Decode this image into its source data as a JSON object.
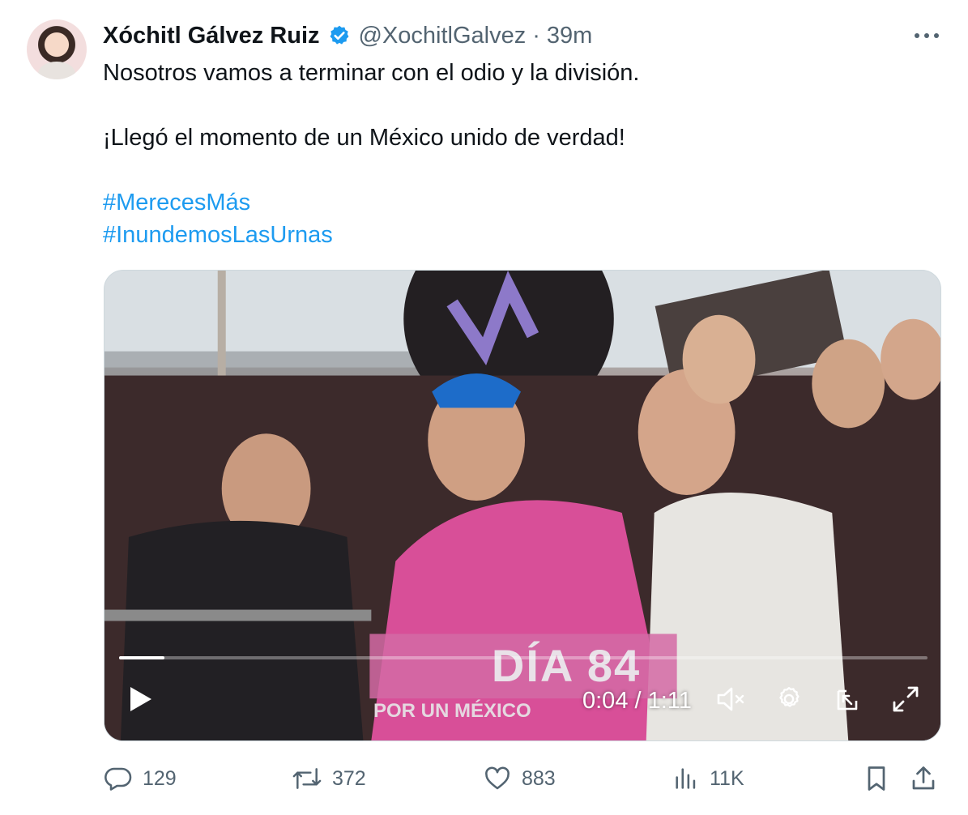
{
  "tweet": {
    "author_name": "Xóchitl Gálvez Ruiz",
    "handle": "@XochitlGalvez",
    "separator": "·",
    "time": "39m",
    "lines": [
      "Nosotros vamos a terminar con el odio y la división.",
      "¡Llegó el momento de un México unido de verdad!"
    ],
    "hashtags": [
      "#MerecesMás",
      "#InundemosLasUrnas"
    ]
  },
  "video": {
    "overlay_title": "DÍA 84",
    "overlay_subtitle": "POR UN MÉXICO",
    "current_time": "0:04",
    "duration": "1:11",
    "time_display": "0:04 / 1:11",
    "progress_fraction": 0.056
  },
  "actions": {
    "replies": "129",
    "reposts": "372",
    "likes": "883",
    "views": "11K"
  },
  "icons": {
    "verified": "verified-badge-icon",
    "more": "more-icon",
    "play": "play-icon",
    "mute": "mute-icon",
    "settings": "gear-icon",
    "pip": "picture-in-picture-icon",
    "fullscreen": "fullscreen-icon",
    "reply": "reply-icon",
    "repost": "repost-icon",
    "like": "heart-icon",
    "views": "views-icon",
    "bookmark": "bookmark-icon",
    "share": "share-icon"
  },
  "colors": {
    "link": "#1d9bf0",
    "secondary_text": "#536471",
    "verified": "#1d9bf0"
  }
}
